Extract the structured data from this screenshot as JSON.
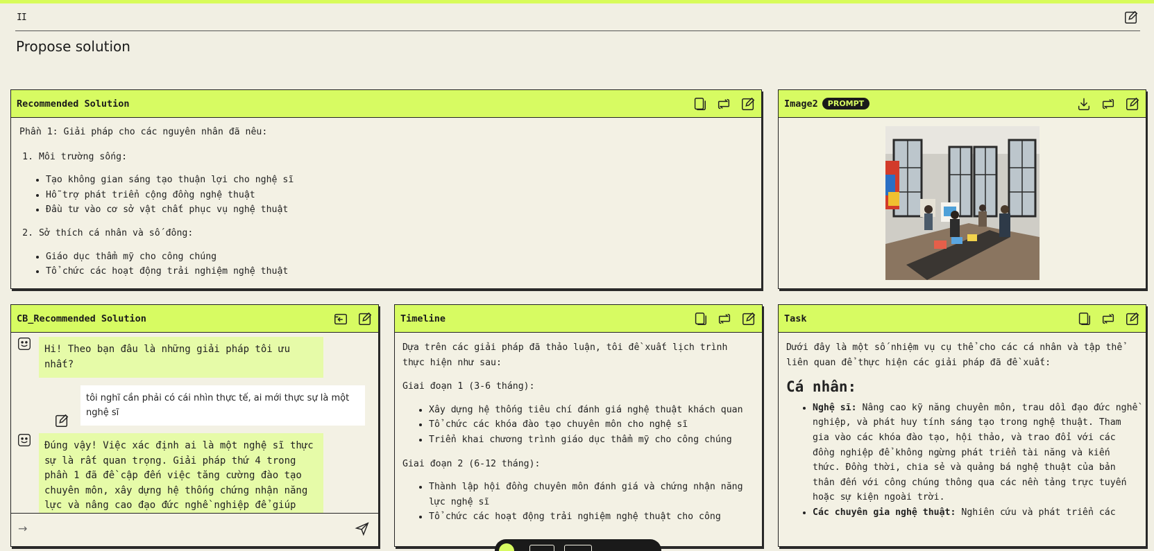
{
  "header": {
    "pause_glyph": "II"
  },
  "page_title": "Propose solution",
  "panels": {
    "recommended": {
      "title": "Recommended Solution",
      "intro": "Phần 1: Giải pháp cho các nguyên nhân đã nêu:",
      "s1_heading": "Môi trường sống:",
      "s1_items": [
        "Tạo không gian sáng tạo thuận lợi cho nghệ sĩ",
        "Hỗ trợ phát triển cộng đồng nghệ thuật",
        "Đầu tư vào cơ sở vật chất phục vụ nghệ thuật"
      ],
      "s2_heading": "Sở thích cá nhân và số đông:",
      "s2_items": [
        "Giáo dục thẩm mỹ cho công chúng",
        "Tổ chức các hoạt động trải nghiệm nghệ thuật"
      ]
    },
    "image2": {
      "title": "Image2",
      "badge": "PROMPT"
    },
    "chat": {
      "title": "CB_Recommended Solution",
      "msg1": "Hi! Theo bạn đâu là những giải pháp tôi ưu nhất?",
      "msg2": "tôi nghĩ cần phải có cái nhìn thực tế, ai mới thực sự là một nghệ sĩ",
      "msg3": "Đúng vậy! Việc xác định ai là một nghệ sĩ thực sự là rất quan trọng. Giải pháp thứ 4 trong phần 1 đã đề cập đến việc tăng cường đào tạo chuyên môn, xây dựng hệ thống chứng nhận năng lực và nâng cao đạo đức nghề nghiệp để giúp nhận",
      "input_arrow": "→"
    },
    "timeline": {
      "title": "Timeline",
      "intro": "Dựa trên các giải pháp đã thảo luận, tôi đề xuất lịch trình thực hiện như sau:",
      "phase1": "Giai đoạn 1 (3-6 tháng):",
      "phase1_items": [
        "Xây dựng hệ thống tiêu chí đánh giá nghệ thuật khách quan",
        "Tổ chức các khóa đào tạo chuyên môn cho nghệ sĩ",
        "Triển khai chương trình giáo dục thẩm mỹ cho công chúng"
      ],
      "phase2": "Giai đoạn 2 (6-12 tháng):",
      "phase2_items": [
        "Thành lập hội đồng chuyên môn đánh giá và chứng nhận năng lực nghệ sĩ",
        "Tổ chức các hoạt động trải nghiệm nghệ thuật cho công"
      ]
    },
    "task": {
      "title": "Task",
      "intro": "Dưới đây là một số nhiệm vụ cụ thể cho các cá nhân và tập thể liên quan để thực hiện các giải pháp đã đề xuất:",
      "heading": "Cá nhân:",
      "item1_label": "Nghệ sĩ:",
      "item1_text": " Nâng cao kỹ năng chuyên môn, trau dồi đạo đức nghề nghiệp, và phát huy tính sáng tạo trong nghệ thuật. Tham gia vào các khóa đào tạo, hội thảo, và trao đổi với các đồng nghiệp để không ngừng phát triển tài năng và kiến thức. Đồng thời, chia sẻ và quảng bá nghệ thuật của bản thân đến với công chúng thông qua các nền tảng trực tuyến hoặc sự kiện ngoài trời.",
      "item2_label": "Các chuyên gia nghệ thuật:",
      "item2_text": " Nghiên cứu và phát triển các"
    }
  },
  "colors": {
    "accent": "#d7fb62",
    "background": "#f1efe3",
    "ai_bubble": "#e6fba8",
    "ink": "#1a1a1a"
  }
}
